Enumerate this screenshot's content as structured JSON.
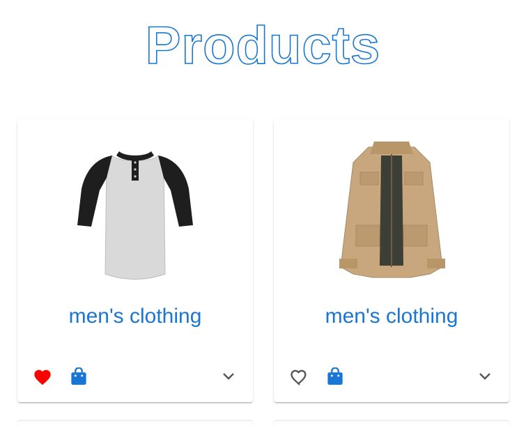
{
  "page": {
    "title": "Products"
  },
  "colors": {
    "accent": "#1976d2",
    "favorite_active": "#ff0000",
    "icon_inactive": "#555555"
  },
  "products": [
    {
      "category": "men's clothing",
      "image_icon": "raglan-henley-shirt-image",
      "favorited": true,
      "actions": [
        "heart-icon",
        "shopping-bag-icon",
        "chevron-down-icon"
      ]
    },
    {
      "category": "men's clothing",
      "image_icon": "khaki-jacket-image",
      "favorited": false,
      "actions": [
        "heart-outline-icon",
        "shopping-bag-icon",
        "chevron-down-icon"
      ]
    }
  ]
}
